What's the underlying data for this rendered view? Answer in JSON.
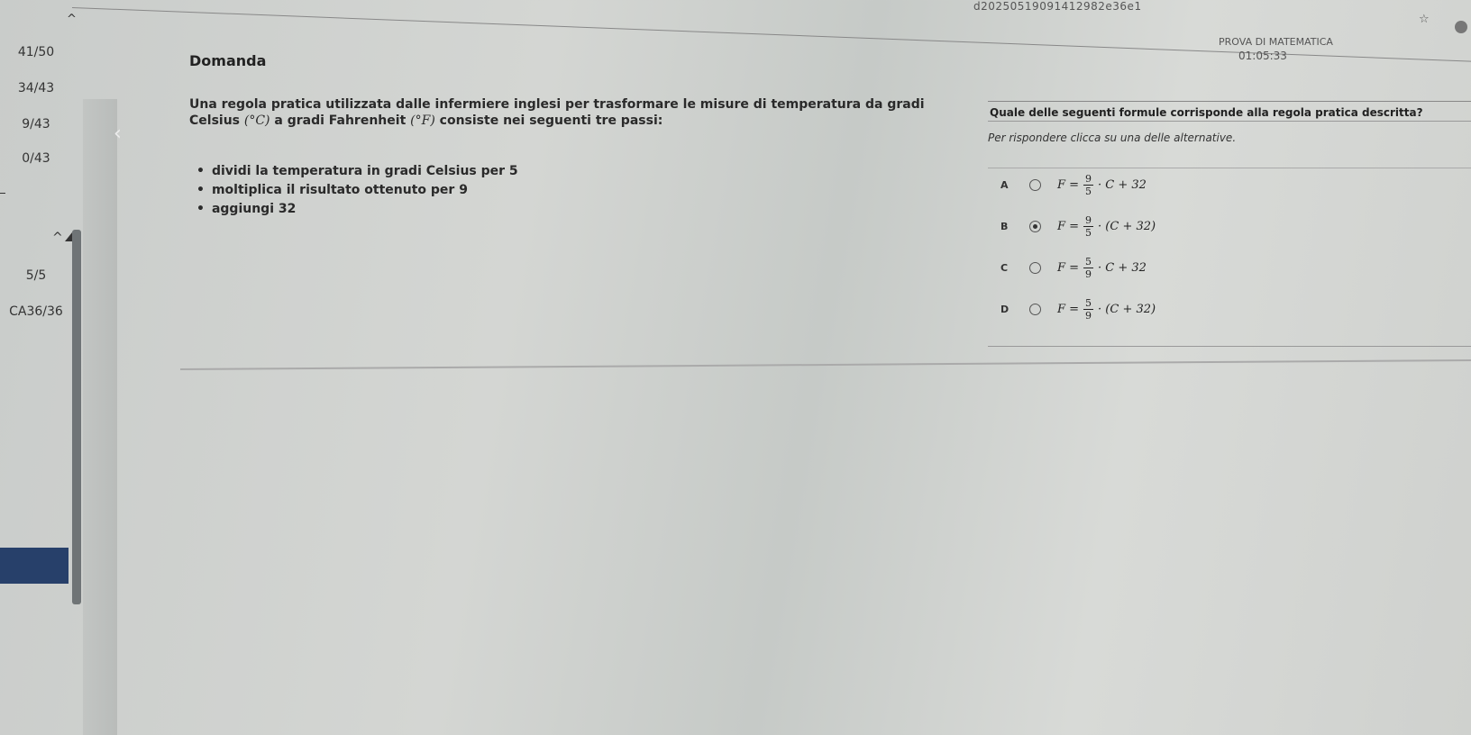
{
  "browser": {
    "url_fragment": "d20250519091412982e36e1"
  },
  "sidebar": {
    "scores": [
      "41/50",
      "34/43",
      "9/43",
      "0/43",
      "5/5",
      "CA36/36"
    ]
  },
  "status": {
    "exam_title": "PROVA DI MATEMATICA",
    "timer": "01:05:33"
  },
  "question": {
    "heading": "Domanda",
    "text_part1": "Una regola pratica utilizzata dalle infermiere inglesi per trasformare le misure di temperatura da gradi Celsius",
    "celsius_symbol": "(°C)",
    "text_part2": "a gradi Fahrenheit",
    "fahrenheit_symbol": "(°F)",
    "text_part3": "consiste nei seguenti tre passi:",
    "steps": [
      "dividi la temperatura in gradi Celsius per 5",
      "moltiplica il risultato ottenuto per 9",
      "aggiungi 32"
    ]
  },
  "answer": {
    "prompt": "Quale delle seguenti formule corrisponde alla regola pratica descritta?",
    "hint": "Per rispondere clicca su una delle alternative.",
    "options": [
      {
        "letter": "A",
        "lhs": "F =",
        "num": "9",
        "den": "5",
        "rhs": "· C + 32",
        "selected": false
      },
      {
        "letter": "B",
        "lhs": "F =",
        "num": "9",
        "den": "5",
        "rhs": "· (C + 32)",
        "selected": true
      },
      {
        "letter": "C",
        "lhs": "F =",
        "num": "5",
        "den": "9",
        "rhs": "· C + 32",
        "selected": false
      },
      {
        "letter": "D",
        "lhs": "F =",
        "num": "5",
        "den": "9",
        "rhs": "· (C + 32)",
        "selected": false
      }
    ]
  }
}
